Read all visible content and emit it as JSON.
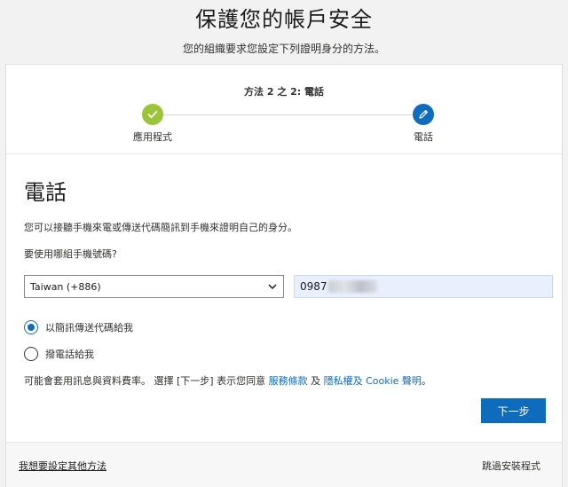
{
  "header": {
    "title": "保護您的帳戶安全",
    "subtitle": "您的組織要求您設定下列證明身分的方法。"
  },
  "steps": {
    "title": "方法 2 之 2: 電話",
    "items": [
      {
        "label": "應用程式",
        "state": "done",
        "icon": "check-icon"
      },
      {
        "label": "電話",
        "state": "current",
        "icon": "pencil-icon"
      }
    ]
  },
  "section": {
    "title": "電話",
    "description": "您可以接聽手機來電或傳送代碼簡訊到手機來證明自己的身分。",
    "question": "要使用哪組手機號碼?"
  },
  "phone": {
    "country_selected": "Taiwan (+886)",
    "number_prefix": "0987"
  },
  "options": {
    "sms_label": "以簡訊傳送代碼給我",
    "call_label": "撥電話給我",
    "selected": "sms"
  },
  "terms": {
    "prefix": "可能會套用訊息與資料費率。 選擇 [下一步] 表示您同意 ",
    "service_link": "服務條款",
    "and": " 及 ",
    "privacy_link": "隱私權及 Cookie 聲明",
    "suffix": "。"
  },
  "buttons": {
    "next": "下一步"
  },
  "footer": {
    "other_methods": "我想要設定其他方法",
    "skip": "跳過安裝程式"
  },
  "colors": {
    "accent": "#0f6cbd",
    "done": "#9bc539"
  }
}
